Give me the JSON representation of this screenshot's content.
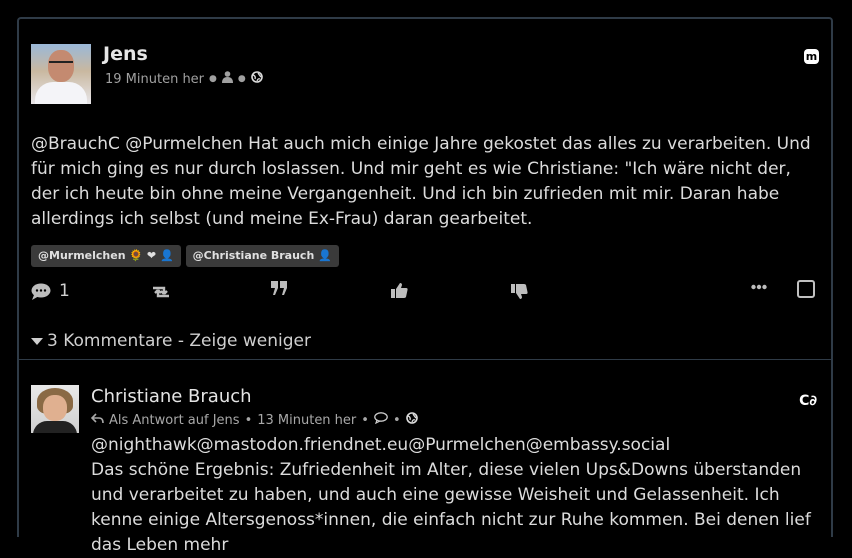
{
  "post": {
    "author": "Jens",
    "time": "19 Minuten her",
    "network_icon": "mastodon-icon",
    "text": "@BrauchC @Purmelchen Hat auch mich einige Jahre gekostet das alles zu verarbeiten. Und für mich ging es nur durch loslassen. Und mir geht es wie Christiane: \"Ich wäre nicht der, der ich heute bin ohne meine Vergangenheit. Und ich bin zufrieden mit mir. Daran habe allerdings ich selbst (und meine Ex-Frau) daran gearbeitet.",
    "tags": [
      {
        "label": "@Murmelchen 🌻 ❤ 👤"
      },
      {
        "label": "@Christiane Brauch 👤"
      }
    ],
    "comment_count": "1",
    "comments_toggle": "3 Kommentare - Zeige weniger"
  },
  "comment": {
    "author": "Christiane Brauch",
    "reply_to": "Als Antwort auf Jens",
    "time": "13 Minuten her",
    "mention_line": "@nighthawk@mastodon.friendnet.eu@Purmelchen@embassy.social",
    "text": "Das schöne Ergebnis: Zufriedenheit im Alter, diese vielen Ups&Downs überstanden und verarbeitet zu haben, und auch eine gewisse Weisheit und Gelassenheit. Ich kenne einige Altersgenoss*innen, die einfach nicht zur Ruhe kommen. Bei denen lief das Leben mehr"
  },
  "colors": {
    "background": "#000000",
    "border": "#2f3b47",
    "tag_bg": "#3a3a3a",
    "text": "#dcdcdc",
    "muted": "#a0a0a0"
  }
}
